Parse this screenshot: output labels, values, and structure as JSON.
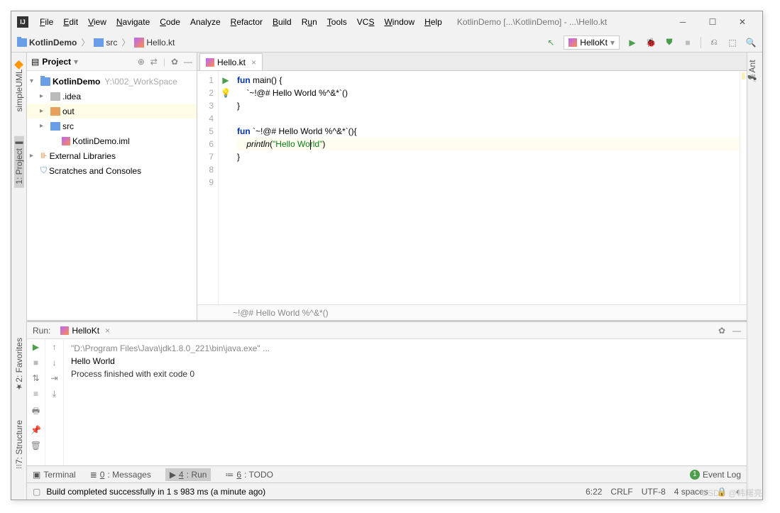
{
  "window": {
    "title": "KotlinDemo [...\\KotlinDemo] - ...\\Hello.kt"
  },
  "menu": {
    "file": "File",
    "edit": "Edit",
    "view": "View",
    "navigate": "Navigate",
    "code": "Code",
    "analyze": "Analyze",
    "refactor": "Refactor",
    "build": "Build",
    "run": "Run",
    "tools": "Tools",
    "vcs": "VCS",
    "window": "Window",
    "help": "Help"
  },
  "breadcrumb": {
    "project": "KotlinDemo",
    "src": "src",
    "file": "Hello.kt"
  },
  "run_config": {
    "selected": "HelloKt"
  },
  "left_tabs": {
    "simpleuml": "simpleUML",
    "project": "1: Project",
    "favorites": "2: Favorites",
    "structure": "7: Structure"
  },
  "right_tabs": {
    "ant": "Ant"
  },
  "project_tool": {
    "title": "Project",
    "root": "KotlinDemo",
    "root_hint": "Y:\\002_WorkSpace",
    "idea": ".idea",
    "out": "out",
    "src": "src",
    "iml": "KotlinDemo.iml",
    "ext": "External Libraries",
    "scratches": "Scratches and Consoles"
  },
  "editor": {
    "tab": "Hello.kt",
    "line1_kw": "fun",
    "line1_rest": " main() {",
    "line2": "    `~!@# Hello World %^&*`()",
    "line3": "}",
    "line5_kw": "fun",
    "line5_rest": " `~!@# Hello World %^&*`(){",
    "line6_fn": "println",
    "line6_open": "(",
    "line6_str_a": "\"Hello Wo",
    "line6_str_b": "rld\"",
    "line6_close": ")",
    "line7": "}",
    "breadcrumb": "~!@# Hello World %^&*()",
    "line_numbers": [
      "1",
      "2",
      "3",
      "4",
      "5",
      "6",
      "7",
      "8",
      "9"
    ]
  },
  "run_panel": {
    "title": "Run:",
    "tab": "HelloKt",
    "cmd": "\"D:\\Program Files\\Java\\jdk1.8.0_221\\bin\\java.exe\" ...",
    "out": "Hello World",
    "exit": "Process finished with exit code 0"
  },
  "bottom": {
    "terminal": "Terminal",
    "messages": "0: Messages",
    "run": "4: Run",
    "todo": "6: TODO",
    "eventlog": "Event Log"
  },
  "status": {
    "build": "Build completed successfully in 1 s 983 ms (a minute ago)",
    "pos": "6:22",
    "eol": "CRLF",
    "enc": "UTF-8",
    "indent": "4 spaces"
  },
  "watermark": "CSDN @韩曙亮"
}
